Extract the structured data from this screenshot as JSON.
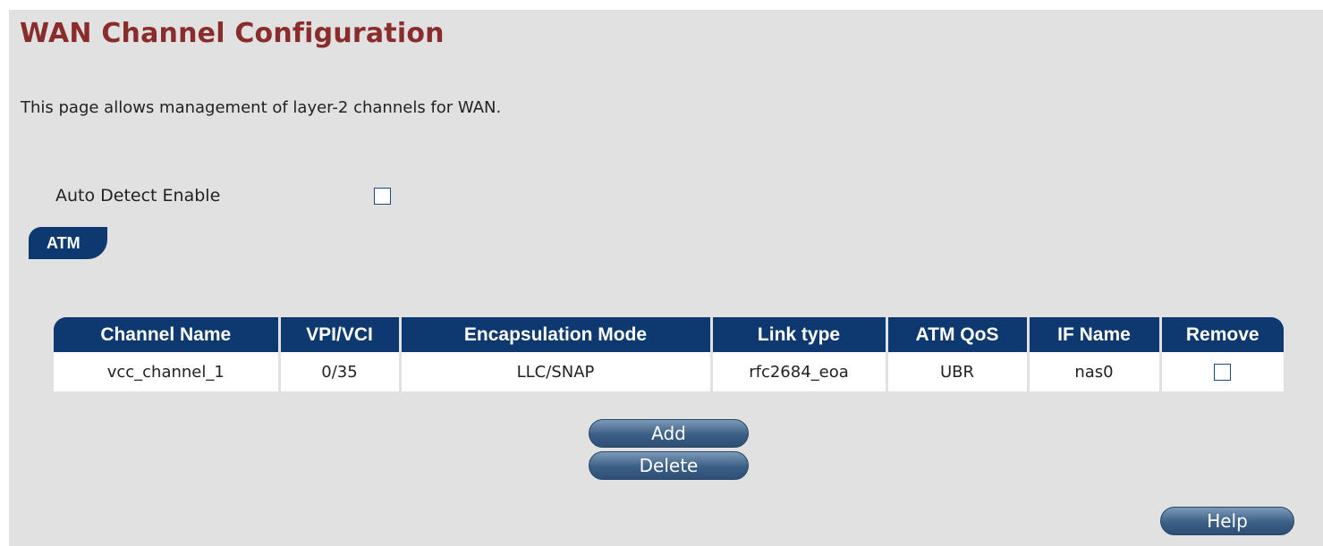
{
  "page": {
    "title": "WAN Channel Configuration",
    "description": "This page allows management of layer-2 channels for WAN."
  },
  "auto_detect": {
    "label": "Auto Detect Enable",
    "checked": false
  },
  "atm_tab": {
    "label": "ATM"
  },
  "table": {
    "headers": [
      "Channel Name",
      "VPI/VCI",
      "Encapsulation Mode",
      "Link type",
      "ATM QoS",
      "IF Name",
      "Remove"
    ],
    "rows": [
      {
        "channel_name": "vcc_channel_1",
        "vpi_vci": "0/35",
        "encapsulation": "LLC/SNAP",
        "link_type": "rfc2684_eoa",
        "atm_qos": "UBR",
        "if_name": "nas0",
        "remove_checked": false
      }
    ]
  },
  "buttons": {
    "add": "Add",
    "delete": "Delete",
    "help": "Help"
  },
  "colors": {
    "title": "#8b2c2c",
    "header_bg": "#0d3870",
    "page_bg": "#e1e1e1"
  }
}
